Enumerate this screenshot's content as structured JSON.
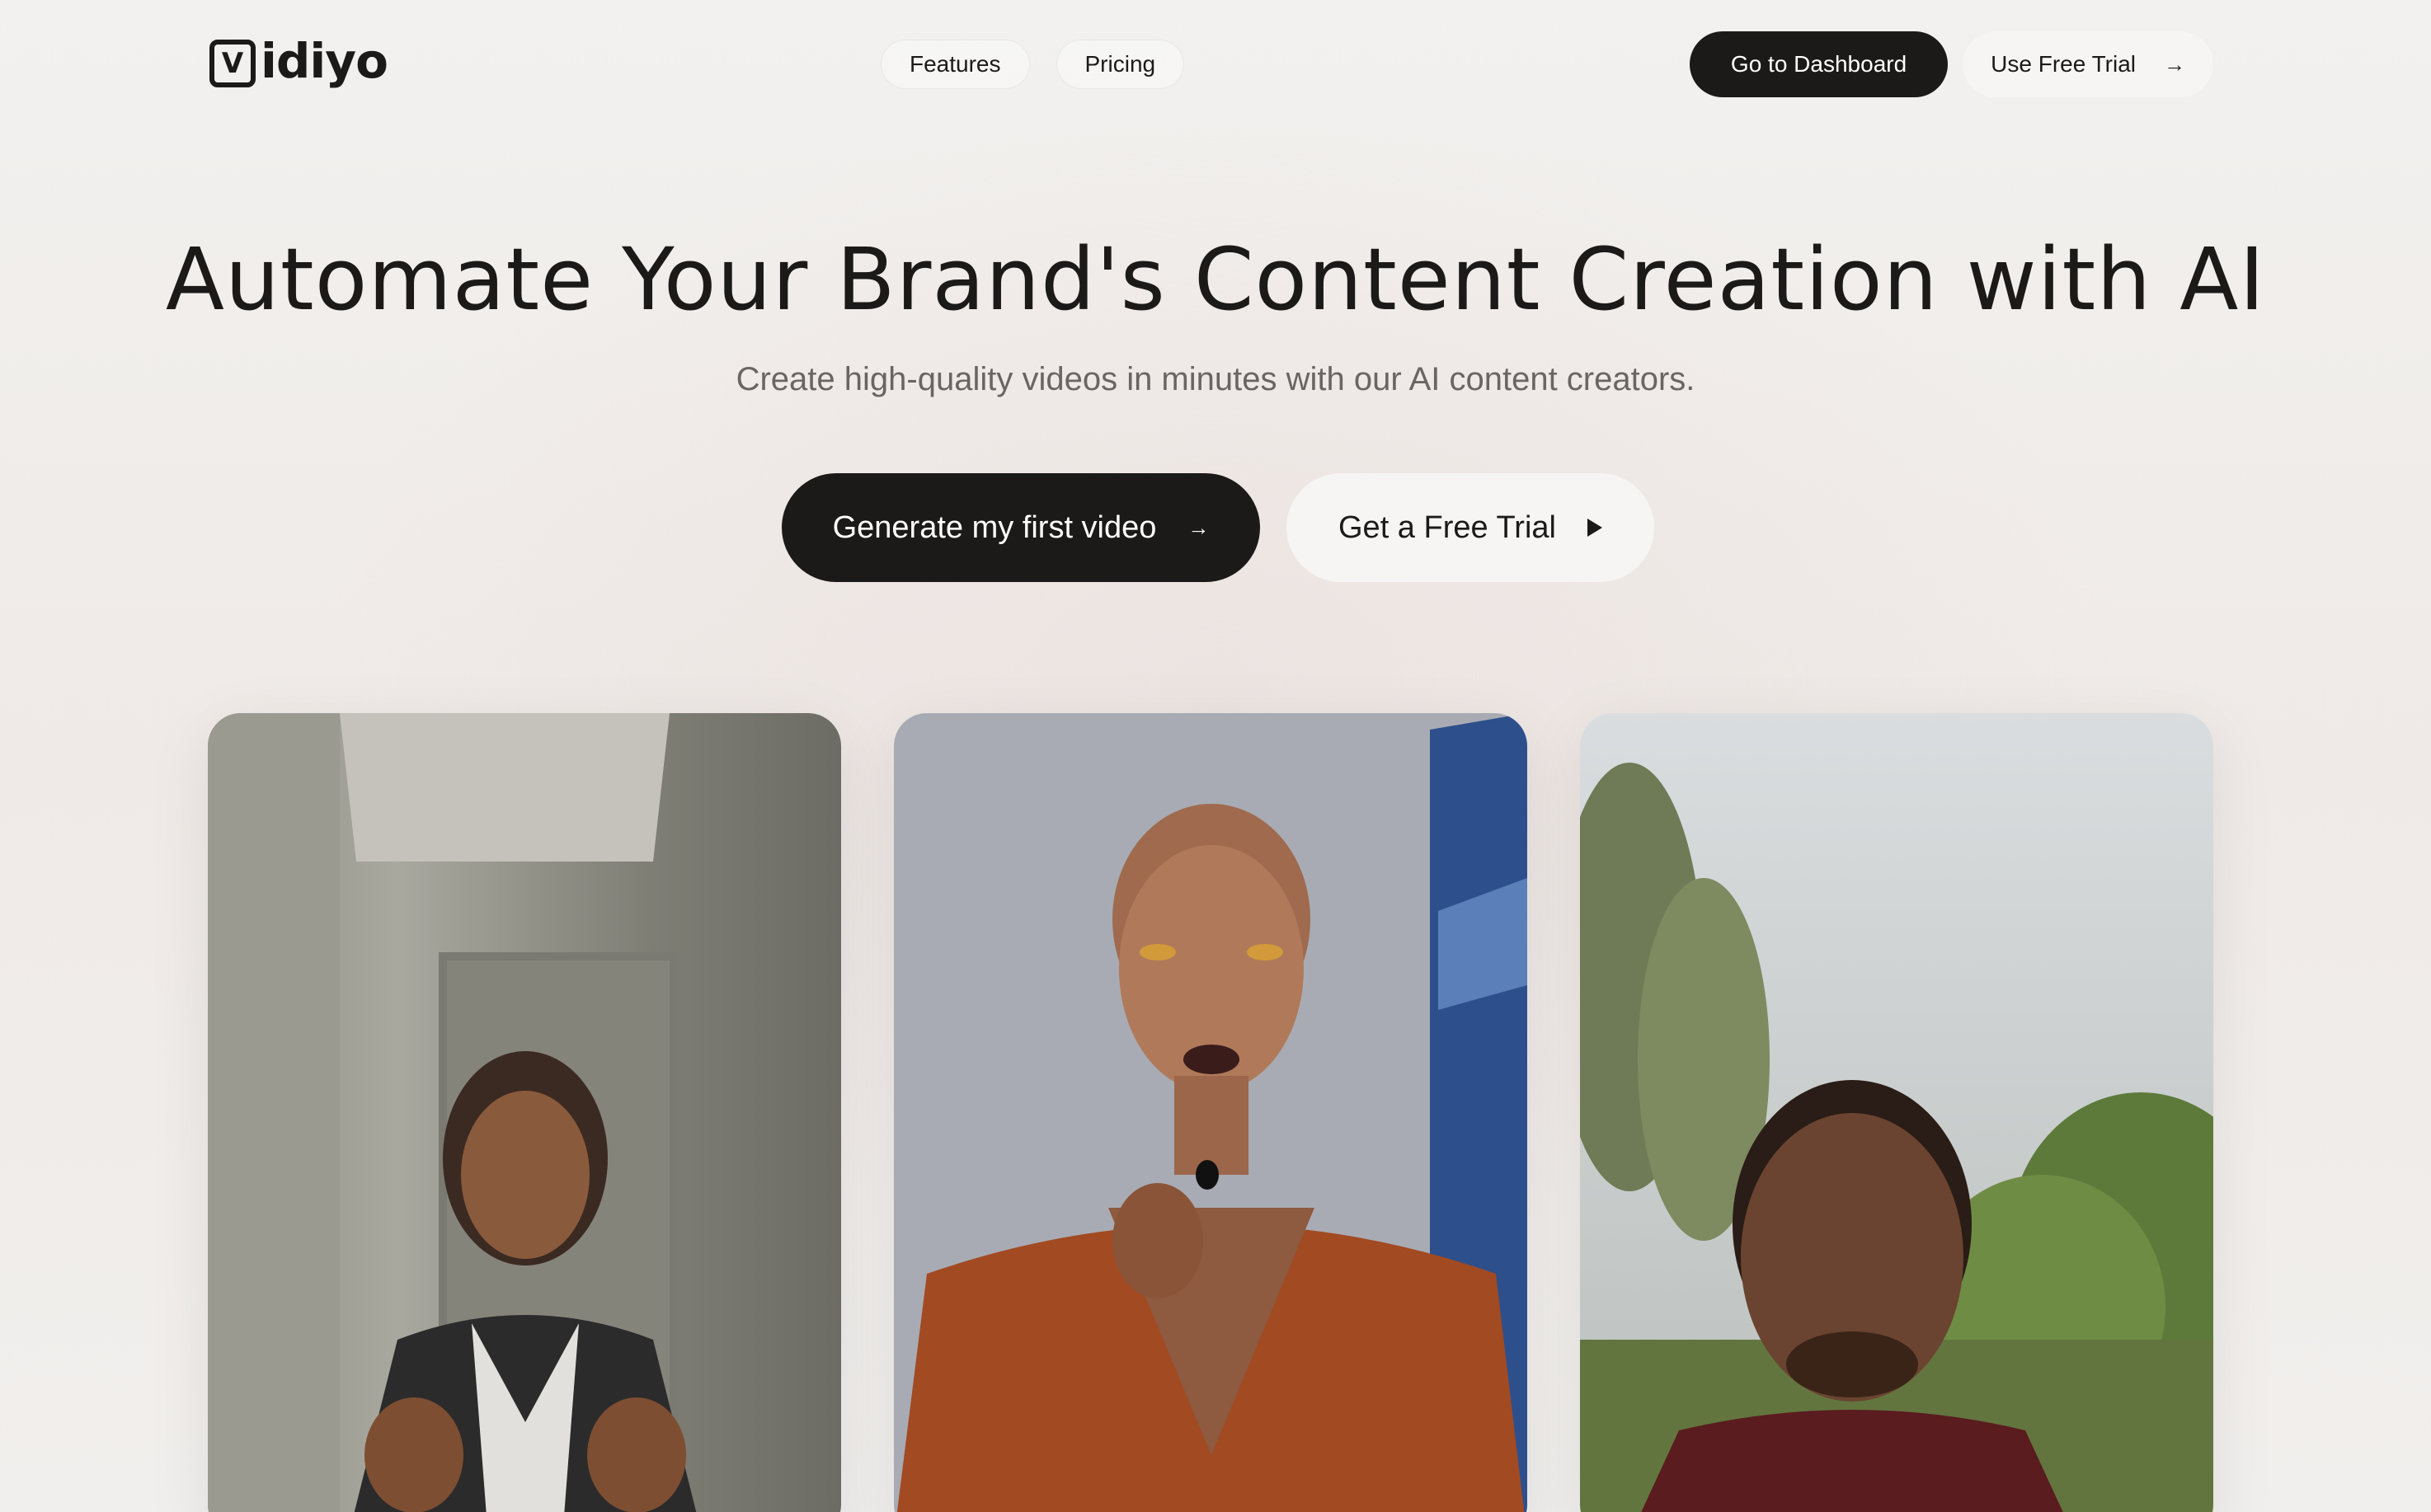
{
  "brand": {
    "logo_letter": "V",
    "logo_text": "idiyo"
  },
  "nav": {
    "features": "Features",
    "pricing": "Pricing"
  },
  "header": {
    "dashboard_label": "Go to Dashboard",
    "trial_label": "Use Free Trial",
    "trial_icon": "arrow-right-icon"
  },
  "hero": {
    "title": "Automate Your Brand's Content Creation with AI",
    "subtitle": "Create high-quality videos in minutes with our AI content creators.",
    "primary_cta": "Generate my first video",
    "primary_icon": "arrow-right-icon",
    "secondary_cta": "Get a Free Trial",
    "secondary_icon": "play-icon"
  },
  "colors": {
    "text": "#1c1a19",
    "muted": "#6a6563",
    "dark_button": "#1c1a19",
    "light_button": "#f6f5f3"
  }
}
